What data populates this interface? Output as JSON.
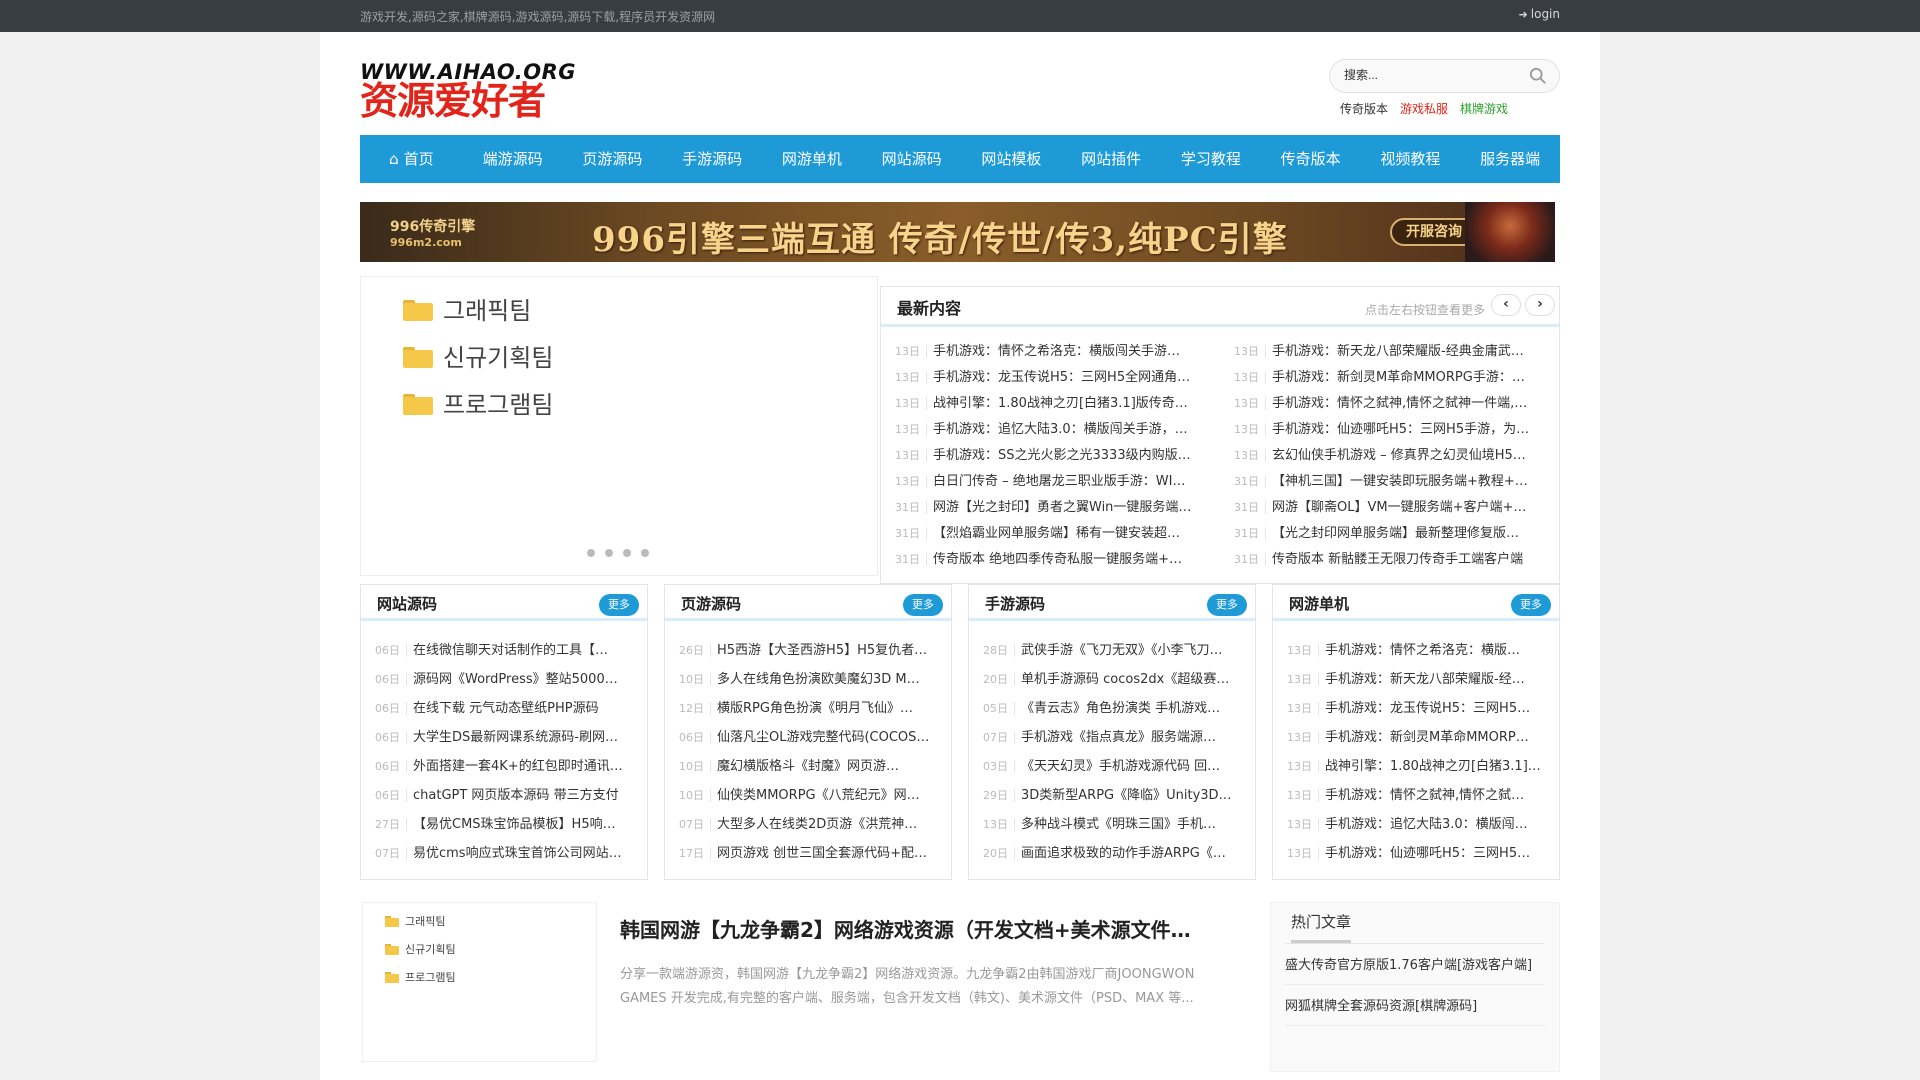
{
  "topbar": {
    "desc": "游戏开发,源码之家,棋牌源码,游戏源码,源码下载,程序员开发资源网",
    "login": "login"
  },
  "logo": {
    "line1": "WWW.AIHAO.ORG",
    "line2": "资源爱好者"
  },
  "search": {
    "placeholder": "搜索...",
    "hotwords": [
      {
        "label": "传奇版本",
        "color": "#333333"
      },
      {
        "label": "游戏私服",
        "color": "#e1251b"
      },
      {
        "label": "棋牌游戏",
        "color": "#2aa22a"
      }
    ]
  },
  "nav": {
    "items": [
      "首页",
      "端游源码",
      "页游源码",
      "手游源码",
      "网游单机",
      "网站源码",
      "网站模板",
      "网站插件",
      "学习教程",
      "传奇版本",
      "视频教程",
      "服务器端"
    ]
  },
  "banner": {
    "brand": "996传奇引擎",
    "brand_url": "996m2.com",
    "text": "996引擎三端互通 传奇/传世/传3,纯PC引擎",
    "button": "开服咨询"
  },
  "slider": {
    "folders": [
      "그래픽팀",
      "신규기획팀",
      "프로그램팀"
    ]
  },
  "latest": {
    "title": "最新内容",
    "tip": "点击左右按钮查看更多",
    "items": [
      {
        "d": "13日",
        "t": "手机游戏：情怀之希洛克：横版闯关手游…"
      },
      {
        "d": "13日",
        "t": "手机游戏：新天龙八部荣耀版-经典金庸武…"
      },
      {
        "d": "13日",
        "t": "手机游戏：龙玉传说H5：三网H5全网通角…"
      },
      {
        "d": "13日",
        "t": "手机游戏：新剑灵M革命MMORPG手游：…"
      },
      {
        "d": "13日",
        "t": "战神引擎：1.80战神之刃[白猪3.1]版传奇…"
      },
      {
        "d": "13日",
        "t": "手机游戏：情怀之弑神,情怀之弑神一件端,…"
      },
      {
        "d": "13日",
        "t": "手机游戏：追忆大陆3.0：横版闯关手游，…"
      },
      {
        "d": "13日",
        "t": "手机游戏：仙迹哪吒H5：三网H5手游，为…"
      },
      {
        "d": "13日",
        "t": "手机游戏：SS之光火影之光3333级内购版…"
      },
      {
        "d": "13日",
        "t": "玄幻仙侠手机游戏 – 修真界之幻灵仙境H5…"
      },
      {
        "d": "13日",
        "t": "白日门传奇 – 绝地屠龙三职业版手游：WI…"
      },
      {
        "d": "31日",
        "t": "【神机三国】一键安装即玩服务端+教程+…"
      },
      {
        "d": "31日",
        "t": "网游【光之封印】勇者之翼Win一键服务端…"
      },
      {
        "d": "31日",
        "t": "网游【聊斋OL】VM一键服务端+客户端+…"
      },
      {
        "d": "31日",
        "t": "【烈焰霸业网单服务端】稀有一键安装超…"
      },
      {
        "d": "31日",
        "t": "【光之封印网单服务端】最新整理修复版…"
      },
      {
        "d": "31日",
        "t": "传奇版本 绝地四季传奇私服一键服务端+…"
      },
      {
        "d": "31日",
        "t": "传奇版本 新骷髅王无限刀传奇手工端客户端"
      }
    ]
  },
  "columns": [
    {
      "title": "网站源码",
      "more": "更多",
      "items": [
        {
          "d": "06日",
          "t": "在线微信聊天对话制作的工具【…"
        },
        {
          "d": "06日",
          "t": "源码网《WordPress》整站5000…"
        },
        {
          "d": "06日",
          "t": "在线下载 元气动态壁纸PHP源码"
        },
        {
          "d": "06日",
          "t": "大学生DS最新网课系统源码-刷网…"
        },
        {
          "d": "06日",
          "t": "外面搭建一套4K+的红包即时通讯…"
        },
        {
          "d": "06日",
          "t": "chatGPT 网页版本源码 带三方支付"
        },
        {
          "d": "27日",
          "t": "【易优CMS珠宝饰品模板】H5响…"
        },
        {
          "d": "07日",
          "t": "易优cms响应式珠宝首饰公司网站…"
        }
      ]
    },
    {
      "title": "页游源码",
      "more": "更多",
      "items": [
        {
          "d": "26日",
          "t": "H5西游【大圣西游H5】H5复仇者…"
        },
        {
          "d": "10日",
          "t": "多人在线角色扮演欧美魔幻3D M…"
        },
        {
          "d": "12日",
          "t": "横版RPG角色扮演《明月飞仙》…"
        },
        {
          "d": "06日",
          "t": "仙落凡尘OL游戏完整代码(COCOS…"
        },
        {
          "d": "10日",
          "t": "魔幻横版格斗《封魔》网页游…"
        },
        {
          "d": "10日",
          "t": "仙侠类MMORPG《八荒纪元》网…"
        },
        {
          "d": "07日",
          "t": "大型多人在线类2D页游《洪荒神…"
        },
        {
          "d": "17日",
          "t": "网页游戏 创世三国全套源代码+配…"
        }
      ]
    },
    {
      "title": "手游源码",
      "more": "更多",
      "items": [
        {
          "d": "28日",
          "t": "武侠手游《飞刀无双》《小李飞刀…"
        },
        {
          "d": "20日",
          "t": "单机手游源码 cocos2dx《超级赛…"
        },
        {
          "d": "05日",
          "t": "《青云志》角色扮演类 手机游戏…"
        },
        {
          "d": "07日",
          "t": "手机游戏《指点真龙》服务端源…"
        },
        {
          "d": "03日",
          "t": "《天天幻灵》手机游戏源代码 回…"
        },
        {
          "d": "29日",
          "t": "3D类新型ARPG《降临》Unity3D…"
        },
        {
          "d": "13日",
          "t": "多种战斗模式《明珠三国》手机…"
        },
        {
          "d": "20日",
          "t": "画面追求极致的动作手游ARPG《…"
        }
      ]
    },
    {
      "title": "网游单机",
      "more": "更多",
      "items": [
        {
          "d": "13日",
          "t": "手机游戏：情怀之希洛克：横版…"
        },
        {
          "d": "13日",
          "t": "手机游戏：新天龙八部荣耀版-经…"
        },
        {
          "d": "13日",
          "t": "手机游戏：龙玉传说H5：三网H5…"
        },
        {
          "d": "13日",
          "t": "手机游戏：新剑灵M革命MMORP…"
        },
        {
          "d": "13日",
          "t": "战神引擎：1.80战神之刃[白猪3.1]…"
        },
        {
          "d": "13日",
          "t": "手机游戏：情怀之弑神,情怀之弑…"
        },
        {
          "d": "13日",
          "t": "手机游戏：追忆大陆3.0：横版闯…"
        },
        {
          "d": "13日",
          "t": "手机游戏：仙迹哪吒H5：三网H5…"
        }
      ]
    }
  ],
  "article": {
    "thumb_folders": [
      "그래픽팀",
      "신규기획팀",
      "프로그램팀"
    ],
    "title": "韩国网游【九龙争霸2】网络游戏资源（开发文档+美术源文件…",
    "desc": "分享一款端游源资，韩国网游【九龙争霸2】网络游戏资源。九龙争霸2由韩国游戏厂商JOONGWON GAMES 开发完成,有完整的客户端、服务端，包含开发文档（韩文)、美术源文件（PSD、MAX 等..."
  },
  "hot": {
    "title": "热门文章",
    "items": [
      "盛大传奇官方原版1.76客户端[游戏客户端]",
      "网狐棋牌全套源码资源[棋牌源码]"
    ]
  },
  "colors": {
    "accent": "#1e9bd7",
    "topbar": "#383d43",
    "brand_red": "#e1251b"
  }
}
